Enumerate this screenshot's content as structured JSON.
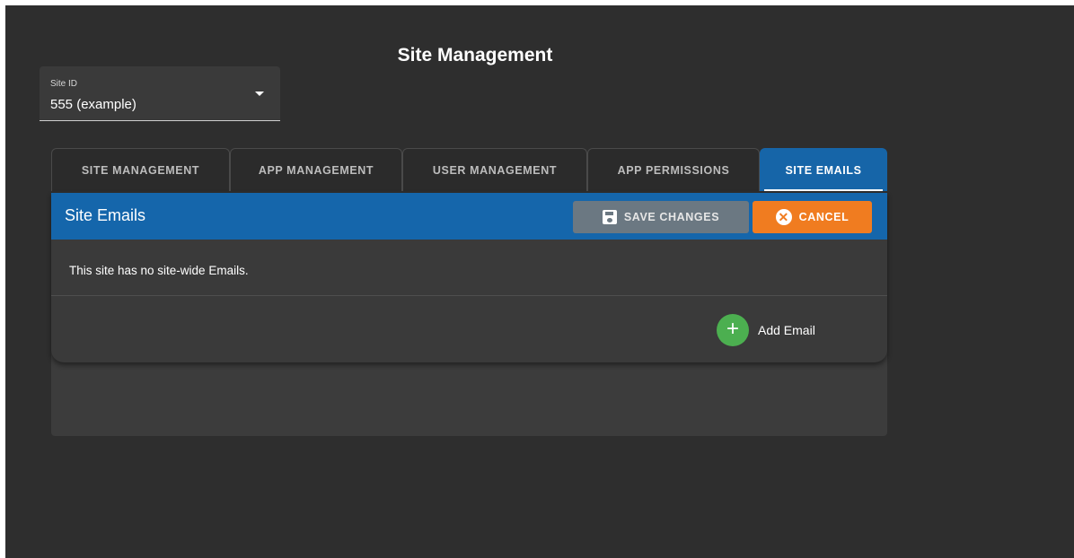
{
  "header": {
    "title": "Site Management"
  },
  "site_select": {
    "label": "Site ID",
    "value": "555 (example)",
    "icon": "caret-down-icon"
  },
  "tabs": [
    {
      "label": "SITE MANAGEMENT",
      "active": false
    },
    {
      "label": "APP MANAGEMENT",
      "active": false
    },
    {
      "label": "USER MANAGEMENT",
      "active": false
    },
    {
      "label": "APP PERMISSIONS",
      "active": false
    },
    {
      "label": "SITE EMAILS",
      "active": true
    }
  ],
  "panel": {
    "title": "Site Emails",
    "save_label": "SAVE CHANGES",
    "save_icon": "floppy-disk-icon",
    "cancel_label": "CANCEL",
    "cancel_icon": "x-circle-icon",
    "empty_message": "This site has no site-wide Emails.",
    "add_label": "Add Email",
    "add_icon": "plus-circle-icon"
  },
  "colors": {
    "background": "#2e2e2e",
    "accent_blue": "#1566ab",
    "save_gray": "#6b7882",
    "cancel_orange": "#f07c20",
    "add_green": "#4caf50"
  }
}
